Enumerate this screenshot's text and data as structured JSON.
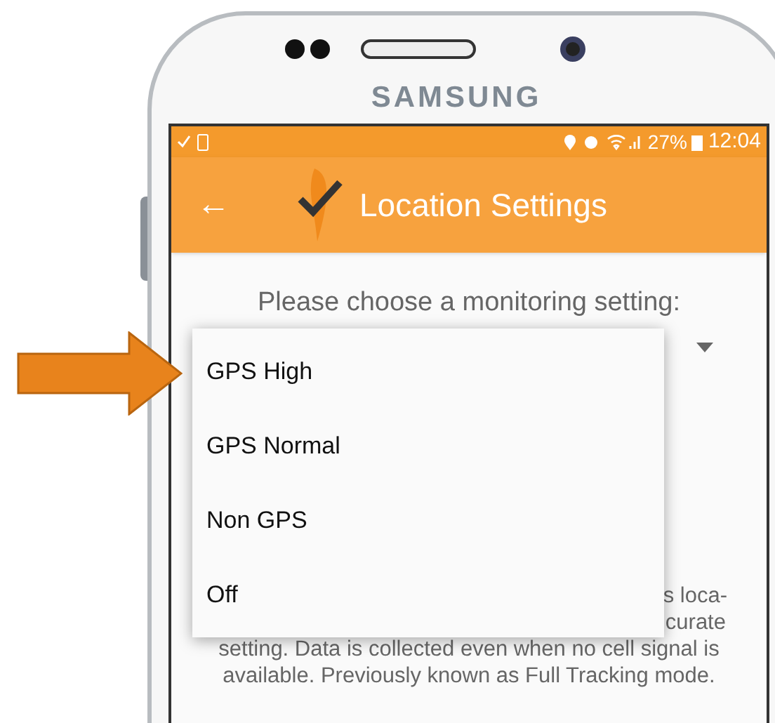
{
  "device": {
    "brand": "SAMSUNG"
  },
  "status_bar": {
    "battery": "27%",
    "time": "12:04"
  },
  "app_bar": {
    "back": "←",
    "title": "Location Settings"
  },
  "prompt": "Please choose a monitoring setting:",
  "description_lines": [
    "s loca-",
    "curate",
    "setting. Data is collected even when no cell signal is",
    "available. Previously known as Full Tracking mode."
  ],
  "menu": {
    "items": [
      {
        "label": "GPS High"
      },
      {
        "label": "GPS Normal"
      },
      {
        "label": "Non GPS"
      },
      {
        "label": "Off"
      }
    ]
  }
}
